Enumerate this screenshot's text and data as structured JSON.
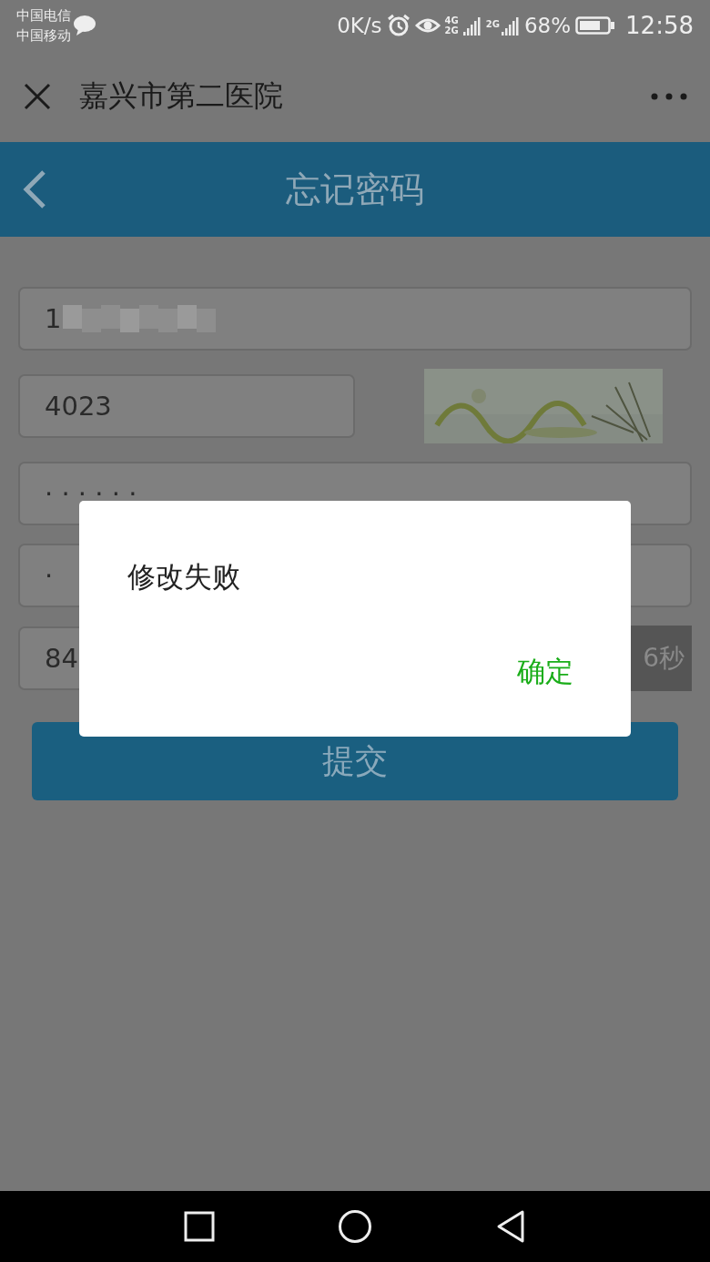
{
  "status_bar": {
    "carriers": [
      "中国电信",
      "中国移动"
    ],
    "speed": "0K/s",
    "network_a": [
      "4G",
      "2G"
    ],
    "network_b": "2G",
    "battery": "68%",
    "time": "12:58"
  },
  "app_bar": {
    "title": "嘉兴市第二医院"
  },
  "header": {
    "title": "忘记密码"
  },
  "form": {
    "fields": [
      {
        "kind": "text",
        "value": "1",
        "redacted": true
      },
      {
        "kind": "captcha",
        "value": "4023"
      },
      {
        "kind": "text",
        "value": "· · · · · ·"
      },
      {
        "kind": "text",
        "value": "·"
      },
      {
        "kind": "code",
        "value": "84",
        "countdown": "6秒"
      }
    ],
    "submit": "提交"
  },
  "dialog": {
    "message": "修改失败",
    "button": "确定"
  }
}
